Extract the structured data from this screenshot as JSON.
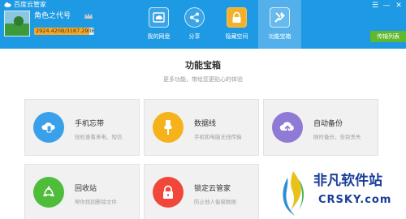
{
  "window": {
    "title": "百度云管家",
    "controls": {
      "menu": "☰",
      "minimize": "—",
      "close": "✕"
    }
  },
  "user": {
    "name": "角色之代号",
    "quota_text": "2924.420B/3187.290B",
    "quota_fraction": 0.918
  },
  "nav": {
    "tabs": [
      {
        "label": "我的网盘",
        "icon": "cloud-drive-icon",
        "active": false
      },
      {
        "label": "分享",
        "icon": "share-icon",
        "active": false
      },
      {
        "label": "隐藏空间",
        "icon": "lock-icon",
        "active": false
      },
      {
        "label": "功能宝箱",
        "icon": "wrench-icon",
        "active": true
      }
    ]
  },
  "transfer": {
    "label": "传输列表"
  },
  "main": {
    "title": "功能宝箱",
    "subtitle": "更多功能，带给您更贴心的体验",
    "cards": [
      {
        "title": "手机忘带",
        "desc": "轻松查看来电、短信",
        "icon": "phone-cloud-icon",
        "color": "#3aa0ea"
      },
      {
        "title": "数据线",
        "desc": "手机和电脑无线传输",
        "icon": "usb-cable-icon",
        "color": "#f5b21a"
      },
      {
        "title": "自动备份",
        "desc": "随时备份，告别丢失",
        "icon": "cloud-upload-icon",
        "color": "#8f7bd6"
      },
      {
        "title": "回收站",
        "desc": "帮你找回删除文件",
        "icon": "recycle-icon",
        "color": "#4fbd3a"
      },
      {
        "title": "锁定云管家",
        "desc": "防止他人偷窥数据",
        "icon": "padlock-icon",
        "color": "#f0473a"
      }
    ]
  },
  "watermark": {
    "text_cn": "非凡软件站",
    "text_en": "CRSKY.com"
  },
  "colors": {
    "header": "#1e99e3",
    "active_tab": "#54b0ea",
    "transfer": "#5fb830",
    "card_bg": "#f1f1f1"
  }
}
